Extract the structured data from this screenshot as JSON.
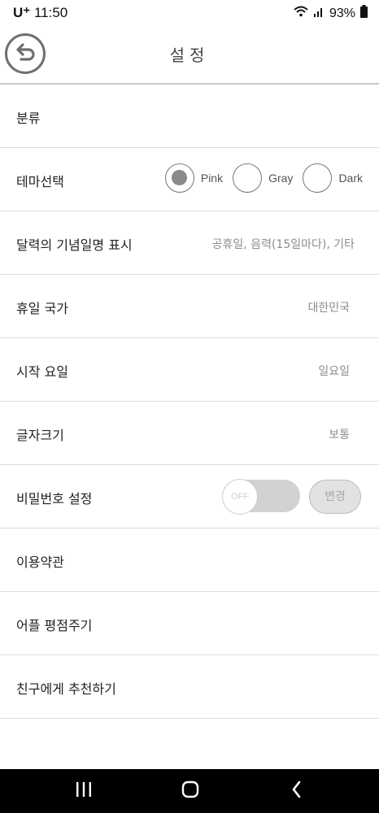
{
  "status_bar": {
    "carrier": "U⁺",
    "time": "11:50",
    "battery": "93%"
  },
  "header": {
    "title": "설정",
    "back_icon": "back-arrow-icon"
  },
  "settings": {
    "category": {
      "label": "분류"
    },
    "theme": {
      "label": "테마선택",
      "options": [
        "Pink",
        "Gray",
        "Dark"
      ],
      "selected": "Pink"
    },
    "calendar_anniversary": {
      "label": "달력의 기념일명 표시",
      "value": "공휴일, 음력(15일마다), 기타"
    },
    "holiday_country": {
      "label": "휴일 국가",
      "value": "대한민국"
    },
    "start_day": {
      "label": "시작 요일",
      "value": "일요일"
    },
    "font_size": {
      "label": "글자크기",
      "value": "보통"
    },
    "password": {
      "label": "비밀번호 설정",
      "toggle_state": "OFF",
      "change_label": "변경"
    },
    "terms": {
      "label": "이용약관"
    },
    "rate_app": {
      "label": "어플 평점주기"
    },
    "recommend": {
      "label": "친구에게 추천하기"
    }
  },
  "colors": {
    "accent_gray": "#8a8a8a",
    "toggle_track": "#d2d2d2",
    "divider": "#dcdcdc"
  }
}
